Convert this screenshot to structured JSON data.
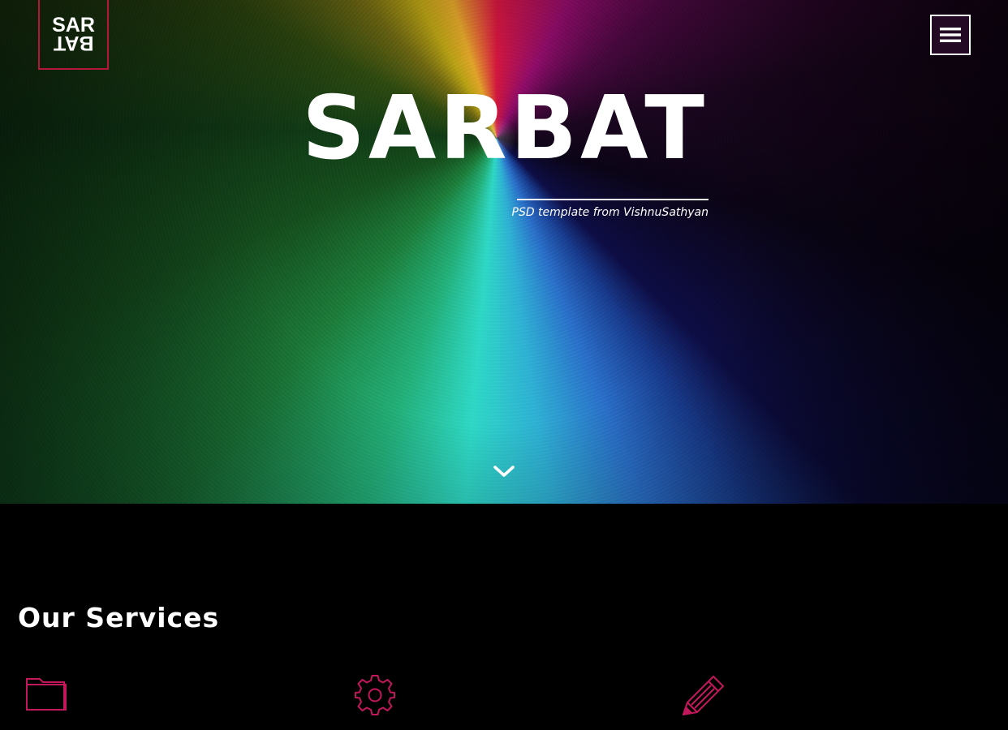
{
  "logo": {
    "top": "SAR",
    "bottom": "BAT"
  },
  "menu": {
    "icon": "hamburger-menu-icon"
  },
  "hero": {
    "title": "SARBAT",
    "subtitle": "PSD template from VishnuSathyan",
    "scroll_icon": "chevron-down-icon"
  },
  "services": {
    "title": "Our Services",
    "icons": [
      "folder-icon",
      "gear-icon",
      "pencil-icon"
    ]
  },
  "colors": {
    "accent": "#c2185b",
    "logo_border": "#b5173b",
    "background": "#000000",
    "text": "#ffffff"
  }
}
